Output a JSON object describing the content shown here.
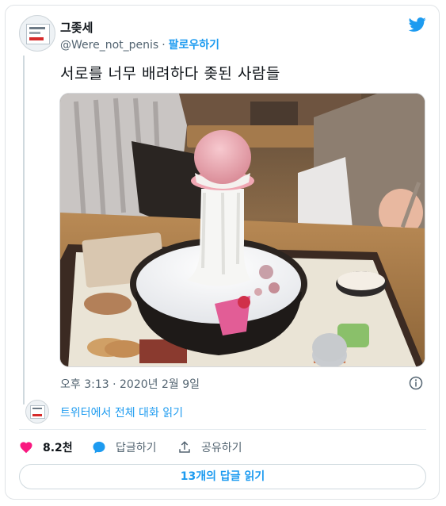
{
  "tweet": {
    "display_name": "그좆세",
    "handle": "@Were_not_penis",
    "separator": "·",
    "follow_label": "팔로우하기",
    "text": "서로를 너무 배려하다 좆된 사람들",
    "timestamp": "오후 3:13 · 2020년 2월 9일",
    "read_conversation_label": "트위터에서 전체 대화 읽기",
    "likes": "8.2천",
    "reply_label": "답글하기",
    "share_label": "공유하기",
    "replies_button_label": "13개의 답글 읽기"
  },
  "icons": {
    "brand": "twitter-bird-icon",
    "info": "info-icon",
    "like": "heart-icon",
    "reply": "speech-bubble-icon",
    "share": "share-icon"
  },
  "colors": {
    "accent": "#1d9bf0",
    "like": "#f91880",
    "secondary_text": "#536471"
  }
}
